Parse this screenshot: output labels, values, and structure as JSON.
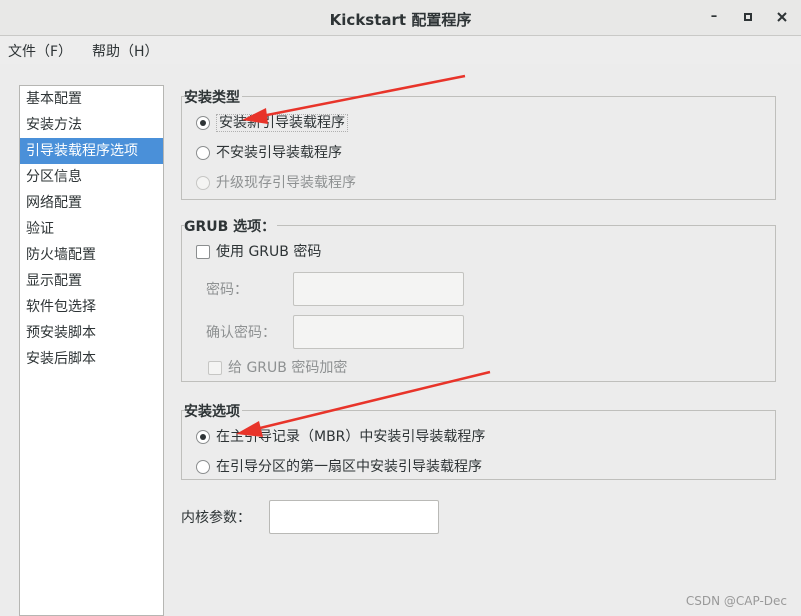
{
  "window": {
    "title": "Kickstart 配置程序",
    "minimize_glyph": "–",
    "maximize_glyph": "▫",
    "close_glyph": "✕"
  },
  "menubar": {
    "items": [
      "文件（F）",
      "帮助（H）"
    ]
  },
  "sidebar": {
    "selected_index": 2,
    "items": [
      "基本配置",
      "安装方法",
      "引导装载程序选项",
      "分区信息",
      "网络配置",
      "验证",
      "防火墙配置",
      "显示配置",
      "软件包选择",
      "预安装脚本",
      "安装后脚本"
    ]
  },
  "install_type": {
    "title": "安装类型",
    "options": [
      {
        "label": "安装新引导装载程序",
        "selected": true,
        "enabled": true
      },
      {
        "label": "不安装引导装载程序",
        "selected": false,
        "enabled": true
      },
      {
        "label": "升级现存引导装载程序",
        "selected": false,
        "enabled": false
      }
    ]
  },
  "grub": {
    "title": "GRUB 选项：",
    "use_password_label": "使用  GRUB 密码",
    "use_password_checked": false,
    "password_label": "密码：",
    "password_value": "",
    "confirm_label": "确认密码：",
    "confirm_value": "",
    "encrypt_label": "给  GRUB 密码加密",
    "encrypt_checked": false
  },
  "install_options": {
    "title": "安装选项",
    "options": [
      {
        "label": "在主引导记录（MBR）中安装引导装载程序",
        "selected": true
      },
      {
        "label": "在引导分区的第一扇区中安装引导装载程序",
        "selected": false
      }
    ]
  },
  "kernel": {
    "label": "内核参数：",
    "value": ""
  },
  "watermark": "CSDN @CAP-Dec",
  "colors": {
    "selection": "#4a90d9",
    "annotation_arrow": "#e8342a"
  }
}
